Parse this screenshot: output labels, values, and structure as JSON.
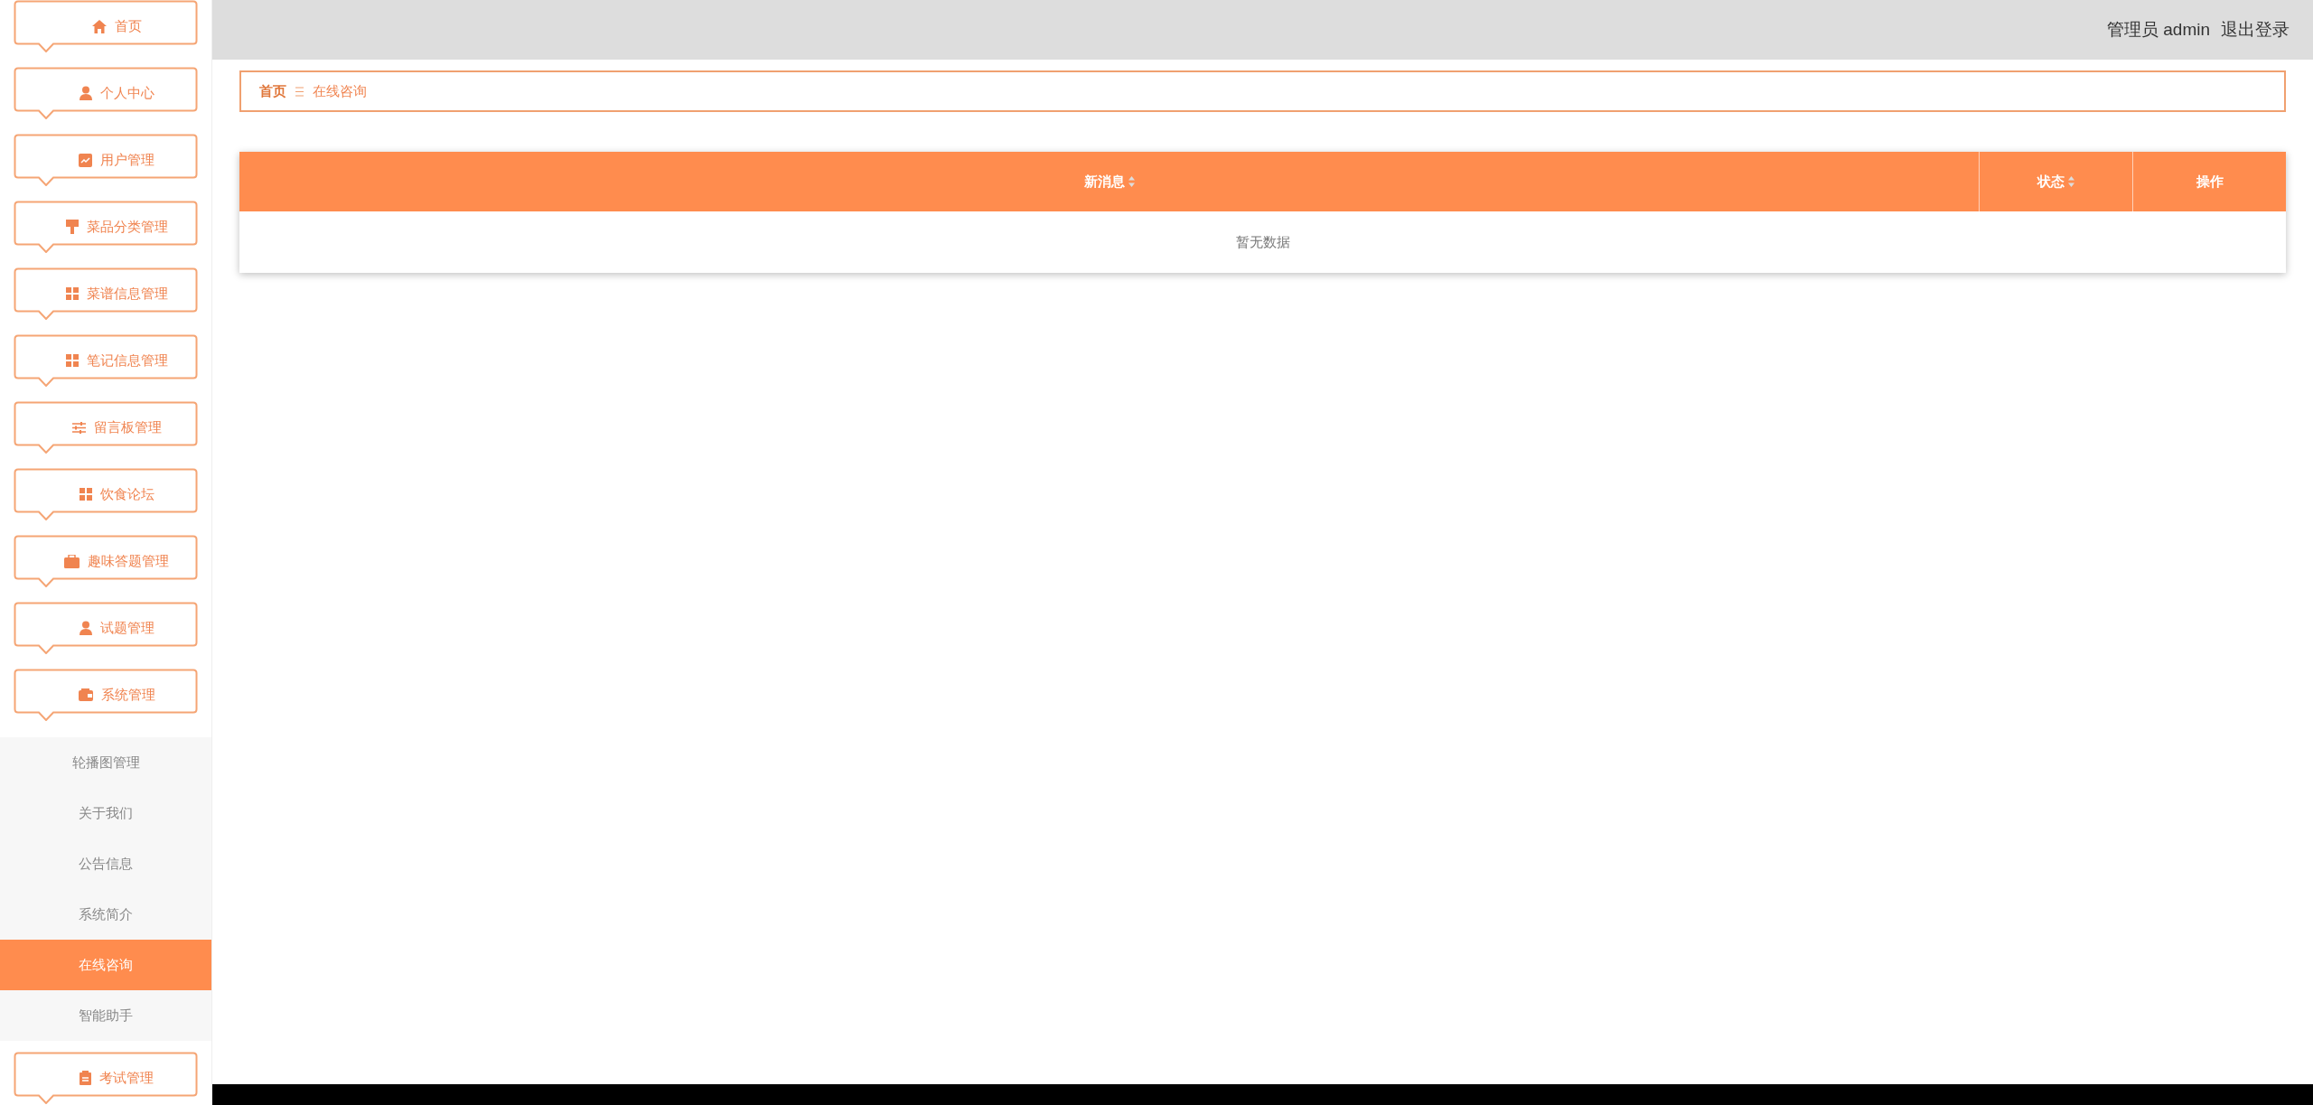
{
  "sidebar": {
    "items": [
      {
        "label": "首页"
      },
      {
        "label": "个人中心"
      },
      {
        "label": "用户管理"
      },
      {
        "label": "菜品分类管理"
      },
      {
        "label": "菜谱信息管理"
      },
      {
        "label": "笔记信息管理"
      },
      {
        "label": "留言板管理"
      },
      {
        "label": "饮食论坛"
      },
      {
        "label": "趣味答题管理"
      },
      {
        "label": "试题管理"
      },
      {
        "label": "系统管理",
        "children": [
          {
            "label": "轮播图管理",
            "selected": false
          },
          {
            "label": "关于我们",
            "selected": false
          },
          {
            "label": "公告信息",
            "selected": false
          },
          {
            "label": "系统简介",
            "selected": false
          },
          {
            "label": "在线咨询",
            "selected": true
          },
          {
            "label": "智能助手",
            "selected": false
          }
        ]
      },
      {
        "label": "考试管理"
      }
    ]
  },
  "header": {
    "user": "管理员 admin",
    "logout": "退出登录"
  },
  "breadcrumb": [
    "首页",
    "在线咨询"
  ],
  "table": {
    "columns": [
      {
        "label": "新消息",
        "sortable": true
      },
      {
        "label": "状态",
        "sortable": true
      },
      {
        "label": "操作",
        "sortable": false
      }
    ],
    "empty_text": "暂无数据"
  }
}
